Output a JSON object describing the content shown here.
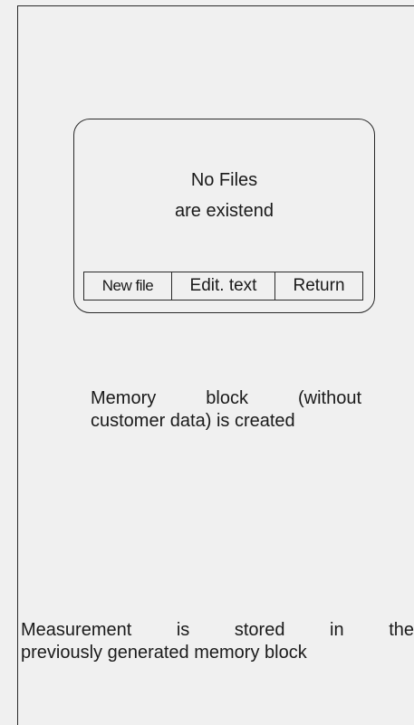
{
  "screen": {
    "message_line1": "No Files",
    "message_line2": "are existend",
    "buttons": {
      "new_file": "New file",
      "edit_text": "Edit. text",
      "return": "Return"
    }
  },
  "notes": {
    "memory_block_line1": "Memory block (without",
    "memory_block_line2": "customer data) is created",
    "measurement_line1": "Measurement is stored in the",
    "measurement_line2": "previously generated memory block"
  }
}
